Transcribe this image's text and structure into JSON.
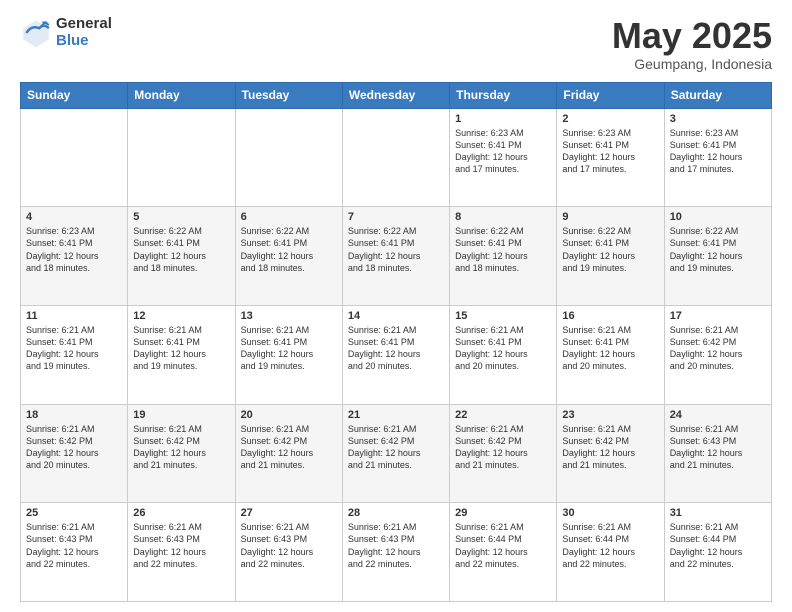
{
  "logo": {
    "general": "General",
    "blue": "Blue"
  },
  "title": "May 2025",
  "subtitle": "Geumpang, Indonesia",
  "days_header": [
    "Sunday",
    "Monday",
    "Tuesday",
    "Wednesday",
    "Thursday",
    "Friday",
    "Saturday"
  ],
  "weeks": [
    [
      {
        "day": "",
        "info": ""
      },
      {
        "day": "",
        "info": ""
      },
      {
        "day": "",
        "info": ""
      },
      {
        "day": "",
        "info": ""
      },
      {
        "day": "1",
        "info": "Sunrise: 6:23 AM\nSunset: 6:41 PM\nDaylight: 12 hours\nand 17 minutes."
      },
      {
        "day": "2",
        "info": "Sunrise: 6:23 AM\nSunset: 6:41 PM\nDaylight: 12 hours\nand 17 minutes."
      },
      {
        "day": "3",
        "info": "Sunrise: 6:23 AM\nSunset: 6:41 PM\nDaylight: 12 hours\nand 17 minutes."
      }
    ],
    [
      {
        "day": "4",
        "info": "Sunrise: 6:23 AM\nSunset: 6:41 PM\nDaylight: 12 hours\nand 18 minutes."
      },
      {
        "day": "5",
        "info": "Sunrise: 6:22 AM\nSunset: 6:41 PM\nDaylight: 12 hours\nand 18 minutes."
      },
      {
        "day": "6",
        "info": "Sunrise: 6:22 AM\nSunset: 6:41 PM\nDaylight: 12 hours\nand 18 minutes."
      },
      {
        "day": "7",
        "info": "Sunrise: 6:22 AM\nSunset: 6:41 PM\nDaylight: 12 hours\nand 18 minutes."
      },
      {
        "day": "8",
        "info": "Sunrise: 6:22 AM\nSunset: 6:41 PM\nDaylight: 12 hours\nand 18 minutes."
      },
      {
        "day": "9",
        "info": "Sunrise: 6:22 AM\nSunset: 6:41 PM\nDaylight: 12 hours\nand 19 minutes."
      },
      {
        "day": "10",
        "info": "Sunrise: 6:22 AM\nSunset: 6:41 PM\nDaylight: 12 hours\nand 19 minutes."
      }
    ],
    [
      {
        "day": "11",
        "info": "Sunrise: 6:21 AM\nSunset: 6:41 PM\nDaylight: 12 hours\nand 19 minutes."
      },
      {
        "day": "12",
        "info": "Sunrise: 6:21 AM\nSunset: 6:41 PM\nDaylight: 12 hours\nand 19 minutes."
      },
      {
        "day": "13",
        "info": "Sunrise: 6:21 AM\nSunset: 6:41 PM\nDaylight: 12 hours\nand 19 minutes."
      },
      {
        "day": "14",
        "info": "Sunrise: 6:21 AM\nSunset: 6:41 PM\nDaylight: 12 hours\nand 20 minutes."
      },
      {
        "day": "15",
        "info": "Sunrise: 6:21 AM\nSunset: 6:41 PM\nDaylight: 12 hours\nand 20 minutes."
      },
      {
        "day": "16",
        "info": "Sunrise: 6:21 AM\nSunset: 6:41 PM\nDaylight: 12 hours\nand 20 minutes."
      },
      {
        "day": "17",
        "info": "Sunrise: 6:21 AM\nSunset: 6:42 PM\nDaylight: 12 hours\nand 20 minutes."
      }
    ],
    [
      {
        "day": "18",
        "info": "Sunrise: 6:21 AM\nSunset: 6:42 PM\nDaylight: 12 hours\nand 20 minutes."
      },
      {
        "day": "19",
        "info": "Sunrise: 6:21 AM\nSunset: 6:42 PM\nDaylight: 12 hours\nand 21 minutes."
      },
      {
        "day": "20",
        "info": "Sunrise: 6:21 AM\nSunset: 6:42 PM\nDaylight: 12 hours\nand 21 minutes."
      },
      {
        "day": "21",
        "info": "Sunrise: 6:21 AM\nSunset: 6:42 PM\nDaylight: 12 hours\nand 21 minutes."
      },
      {
        "day": "22",
        "info": "Sunrise: 6:21 AM\nSunset: 6:42 PM\nDaylight: 12 hours\nand 21 minutes."
      },
      {
        "day": "23",
        "info": "Sunrise: 6:21 AM\nSunset: 6:42 PM\nDaylight: 12 hours\nand 21 minutes."
      },
      {
        "day": "24",
        "info": "Sunrise: 6:21 AM\nSunset: 6:43 PM\nDaylight: 12 hours\nand 21 minutes."
      }
    ],
    [
      {
        "day": "25",
        "info": "Sunrise: 6:21 AM\nSunset: 6:43 PM\nDaylight: 12 hours\nand 22 minutes."
      },
      {
        "day": "26",
        "info": "Sunrise: 6:21 AM\nSunset: 6:43 PM\nDaylight: 12 hours\nand 22 minutes."
      },
      {
        "day": "27",
        "info": "Sunrise: 6:21 AM\nSunset: 6:43 PM\nDaylight: 12 hours\nand 22 minutes."
      },
      {
        "day": "28",
        "info": "Sunrise: 6:21 AM\nSunset: 6:43 PM\nDaylight: 12 hours\nand 22 minutes."
      },
      {
        "day": "29",
        "info": "Sunrise: 6:21 AM\nSunset: 6:44 PM\nDaylight: 12 hours\nand 22 minutes."
      },
      {
        "day": "30",
        "info": "Sunrise: 6:21 AM\nSunset: 6:44 PM\nDaylight: 12 hours\nand 22 minutes."
      },
      {
        "day": "31",
        "info": "Sunrise: 6:21 AM\nSunset: 6:44 PM\nDaylight: 12 hours\nand 22 minutes."
      }
    ]
  ]
}
